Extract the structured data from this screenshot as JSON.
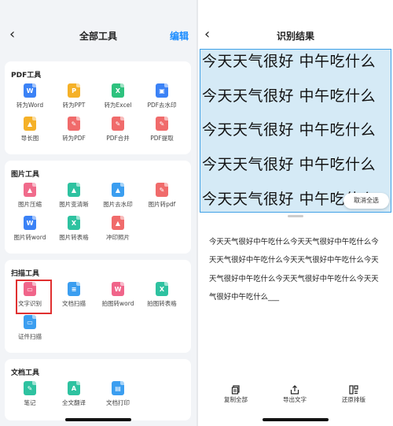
{
  "left": {
    "title": "全部工具",
    "edit_label": "编辑",
    "sections": [
      {
        "title": "PDF工具",
        "tools": [
          {
            "label": "转为Word",
            "icon": "word-icon",
            "color": "#3b82f6",
            "glyph": "W"
          },
          {
            "label": "转为PPT",
            "icon": "ppt-icon",
            "color": "#f5b128",
            "glyph": "P"
          },
          {
            "label": "转为Excel",
            "icon": "excel-icon",
            "color": "#2ec27e",
            "glyph": "X"
          },
          {
            "label": "PDF去水印",
            "icon": "watermark-icon",
            "color": "#3b82f6",
            "glyph": "▣"
          },
          {
            "label": "导长图",
            "icon": "long-image-icon",
            "color": "#f5b128",
            "glyph": "▲"
          },
          {
            "label": "转为PDF",
            "icon": "pdf-icon",
            "color": "#f06b6b",
            "glyph": "✎"
          },
          {
            "label": "PDF合并",
            "icon": "pdf-merge-icon",
            "color": "#f06b6b",
            "glyph": "✎"
          },
          {
            "label": "PDF提取",
            "icon": "pdf-extract-icon",
            "color": "#f06b6b",
            "glyph": "✎"
          }
        ]
      },
      {
        "title": "图片工具",
        "tools": [
          {
            "label": "图片压缩",
            "icon": "image-compress-icon",
            "color": "#f06b8b",
            "glyph": "▲"
          },
          {
            "label": "图片变清晰",
            "icon": "image-sharpen-icon",
            "color": "#2ec2a0",
            "glyph": "▲"
          },
          {
            "label": "图片去水印",
            "icon": "image-watermark-icon",
            "color": "#3b9ef0",
            "glyph": "▲"
          },
          {
            "label": "图片转pdf",
            "icon": "image-to-pdf-icon",
            "color": "#f06b6b",
            "glyph": "✎"
          },
          {
            "label": "图片转word",
            "icon": "image-to-word-icon",
            "color": "#3b82f6",
            "glyph": "W"
          },
          {
            "label": "图片转表格",
            "icon": "image-to-table-icon",
            "color": "#2ec2a0",
            "glyph": "X"
          },
          {
            "label": "冲印照片",
            "icon": "print-photo-icon",
            "color": "#f06b6b",
            "glyph": "▲"
          }
        ]
      },
      {
        "title": "扫描工具",
        "tools": [
          {
            "label": "文字识别",
            "icon": "text-recognition-icon",
            "color": "#f0658a",
            "glyph": "▭"
          },
          {
            "label": "文档扫描",
            "icon": "doc-scan-icon",
            "color": "#3b9ef0",
            "glyph": "≡"
          },
          {
            "label": "拍图转word",
            "icon": "photo-to-word-icon",
            "color": "#f0658a",
            "glyph": "W"
          },
          {
            "label": "拍图转表格",
            "icon": "photo-to-table-icon",
            "color": "#2ec2a0",
            "glyph": "X"
          },
          {
            "label": "证件扫描",
            "icon": "id-scan-icon",
            "color": "#3b9ef0",
            "glyph": "▭"
          }
        ]
      },
      {
        "title": "文档工具",
        "tools": [
          {
            "label": "笔记",
            "icon": "note-icon",
            "color": "#2ec2a0",
            "glyph": "✎"
          },
          {
            "label": "全文翻译",
            "icon": "translate-icon",
            "color": "#2ec2a0",
            "glyph": "A"
          },
          {
            "label": "文档打印",
            "icon": "doc-print-icon",
            "color": "#3b9ef0",
            "glyph": "▤"
          }
        ]
      }
    ]
  },
  "right": {
    "title": "识别结果",
    "ocr_lines": [
      "今天天气很好  中午吃什么",
      "今天天气很好  中午吃什么",
      "今天天气很好  中午吃什么",
      "今天天气很好  中午吃什么",
      "今天天气很好  中午吃什么"
    ],
    "cancel_select_label": "取消全选",
    "result_text": "今天天气很好中午吃什么今天天气很好中午吃什么今天天气很好中午吃什么今天天气很好中午吃什么今天天气很好中午吃什么今天天气很好中午吃什么今天天气很好中午吃什么___",
    "bottom_actions": [
      {
        "label": "复制全部",
        "icon": "copy-icon"
      },
      {
        "label": "导出文字",
        "icon": "export-icon"
      },
      {
        "label": "还原排版",
        "icon": "restore-layout-icon"
      }
    ]
  },
  "colors": {
    "accent": "#1a8cff",
    "highlight": "#e03030",
    "selection_bg": "#d5eaf6"
  }
}
